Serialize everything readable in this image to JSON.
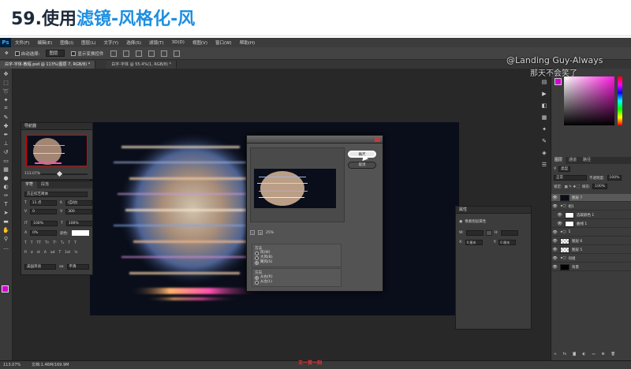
{
  "heading": {
    "number": "59.",
    "prefix": "使用",
    "highlight": "滤镜-风格化-风"
  },
  "menubar": {
    "logo": "Ps",
    "items": [
      "文件(F)",
      "编辑(E)",
      "图像(I)",
      "图层(L)",
      "文字(Y)",
      "选择(S)",
      "滤镜(T)",
      "3D(D)",
      "视图(V)",
      "窗口(W)",
      "帮助(H)"
    ]
  },
  "options": {
    "auto_select": "自动选择:",
    "layer_select": "图层",
    "show_transform": "显示变换控件"
  },
  "tabs": [
    {
      "label": "白字-字体-教程.psd @ 113%(图层 7, RGB/8) *",
      "active": true
    },
    {
      "label": "白字-字体 @ 55.4%(1, RGB/8) *",
      "active": false
    }
  ],
  "navigator": {
    "title": "导航器",
    "zoom": "113.07%"
  },
  "character": {
    "tabs": [
      "字符",
      "段落"
    ],
    "font": "方正综艺简体",
    "size": "11 点",
    "leading": "(自动)",
    "kerning": "0",
    "tracking": "300",
    "scale_v": "100%",
    "scale_h": "100%",
    "baseline": "0%",
    "color_label": "颜色:",
    "lang": "美国英语",
    "aa": "平滑"
  },
  "dialog": {
    "ok": "确定",
    "cancel": "取消",
    "zoom": "25%",
    "method_label": "方法",
    "methods": [
      "风(W)",
      "大风(B)",
      "飓风(S)"
    ],
    "method_selected": 2,
    "direction_label": "方向",
    "directions": [
      "从右(R)",
      "从左(L)"
    ],
    "direction_selected": 0
  },
  "properties": {
    "title": "属性",
    "subtitle": "像素图层属性",
    "w_label": "W:",
    "h_label": "H:",
    "x_label": "X:",
    "y_label": "Y:",
    "x_value": "0 厘米",
    "y_value": "0 厘米"
  },
  "layers_panel": {
    "tabs": [
      "图层",
      "通道",
      "路径"
    ],
    "kind": "类型",
    "blend": "正常",
    "opacity_label": "不透明度:",
    "opacity": "100%",
    "lock_label": "锁定:",
    "fill_label": "填充:",
    "fill": "100%",
    "layers": [
      {
        "name": "图层 7",
        "thumb": "dark",
        "selected": true,
        "sub": false
      },
      {
        "name": "组1",
        "thumb": "none",
        "selected": false,
        "sub": false
      },
      {
        "name": "选取颜色 1",
        "thumb": "white",
        "selected": false,
        "sub": true
      },
      {
        "name": "曲线 1",
        "thumb": "white",
        "selected": false,
        "sub": true
      },
      {
        "name": "1",
        "thumb": "none",
        "selected": false,
        "sub": false
      },
      {
        "name": "图层 6",
        "thumb": "check",
        "selected": false,
        "sub": false
      },
      {
        "name": "图层 5",
        "thumb": "check",
        "selected": false,
        "sub": false
      },
      {
        "name": "问组",
        "thumb": "none",
        "selected": false,
        "sub": false
      },
      {
        "name": "背景",
        "thumb": "dark",
        "selected": false,
        "sub": false
      }
    ]
  },
  "status": {
    "zoom": "113.07%",
    "doc": "文档:1.46M/169.9M"
  },
  "caption": "王一首一刻",
  "watermark": {
    "line1": "@Landing Guy-Always",
    "line2": "那天不会笑了"
  },
  "colors": {
    "foreground": "#d400d4",
    "accent": "#1e8fe0"
  }
}
